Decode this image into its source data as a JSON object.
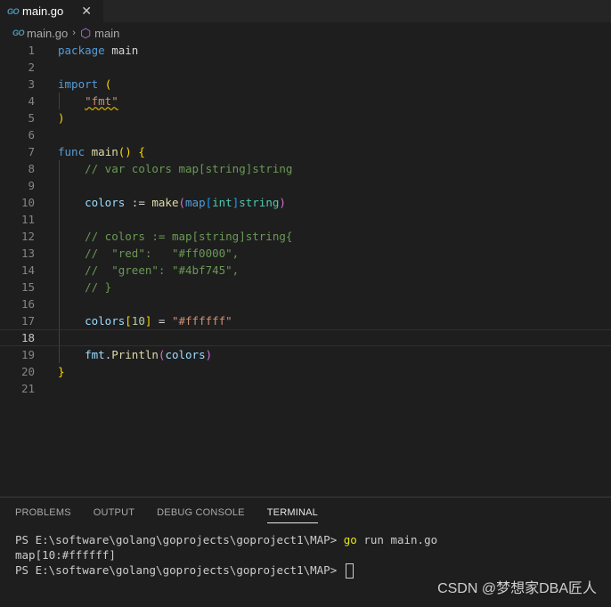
{
  "tab": {
    "icon": "GO",
    "label": "main.go",
    "close": "✕"
  },
  "breadcrumb": {
    "icon": "GO",
    "file": "main.go",
    "separator": "›",
    "symbol_icon": "⬡",
    "symbol": "main"
  },
  "editor": {
    "ln": [
      "1",
      "2",
      "3",
      "4",
      "5",
      "6",
      "7",
      "8",
      "9",
      "10",
      "11",
      "12",
      "13",
      "14",
      "15",
      "16",
      "17",
      "18",
      "19",
      "20",
      "21"
    ],
    "t": {
      "package": "package",
      "main_pkg": "main",
      "import": "import",
      "paren_open": "(",
      "fmt_str": "\"fmt\"",
      "paren_close": ")",
      "func": "func",
      "main_fn": "main",
      "parens": "()",
      "brace_open": "{",
      "c8": "// var colors map[string]string",
      "colors": "colors",
      "assign": " := ",
      "make": "make",
      "lp": "(",
      "map_kw": "map",
      "lb": "[",
      "int": "int",
      "rb": "]",
      "string": "string",
      "rp": ")",
      "c12": "// colors := map[string]string{",
      "c13": "//  \"red\":   \"#ff0000\",",
      "c14": "//  \"green\": \"#4bf745\",",
      "c15": "// }",
      "ten": "10",
      "eq": " = ",
      "white": "\"#ffffff\"",
      "fmt": "fmt",
      "dot": ".",
      "println": "Println",
      "brace_close": "}"
    }
  },
  "panel": {
    "tabs": [
      "PROBLEMS",
      "OUTPUT",
      "DEBUG CONSOLE",
      "TERMINAL"
    ],
    "terminal": {
      "prompt": "PS E:\\software\\golang\\goprojects\\goproject1\\MAP> ",
      "cmd_go": "go",
      "cmd_rest": " run main.go",
      "output": "map[10:#ffffff]"
    }
  },
  "watermark": "CSDN @梦想家DBA匠人",
  "colors": {
    "background": "#1e1e1e",
    "keyword": "#569cd6",
    "function": "#dcdcaa",
    "variable": "#9cdcfe",
    "string": "#ce9178",
    "comment": "#6a9955",
    "type": "#4ec9b0"
  }
}
